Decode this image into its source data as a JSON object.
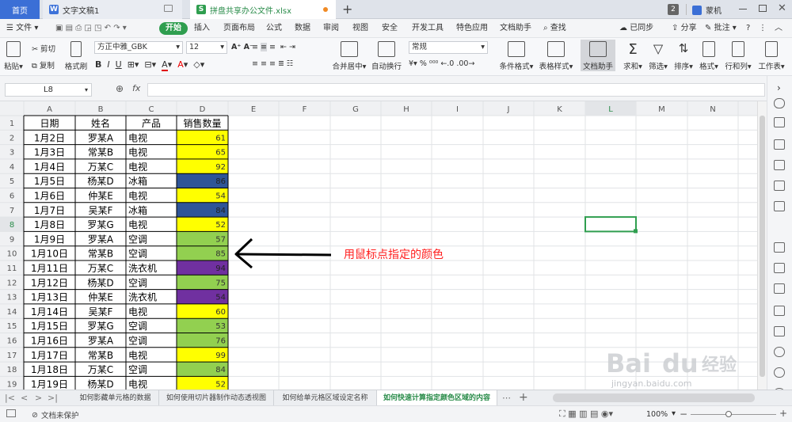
{
  "titlebar": {
    "home": "首页",
    "doc_tab": "文字文稿1",
    "active_tab": "拼盘共享办公文件.xlsx",
    "plus": "+",
    "badge": "2",
    "user": "蒙机"
  },
  "menubar": {
    "file": "文件",
    "items": [
      "开始",
      "插入",
      "页面布局",
      "公式",
      "数据",
      "审阅",
      "视图",
      "安全",
      "开发工具",
      "特色应用",
      "文档助手"
    ],
    "search": "查找",
    "sync": "已同步",
    "share": "分享",
    "comment": "批注"
  },
  "ribbon": {
    "paste": "粘贴",
    "cut": "剪切",
    "copy": "复制",
    "format_painter": "格式刷",
    "font_name": "方正中雅_GBK",
    "font_size": "12",
    "merge": "合并居中",
    "wrap": "自动换行",
    "number_format": "常规",
    "cond_format": "条件格式",
    "table_style": "表格样式",
    "doc_assist": "文档助手",
    "sum": "求和",
    "filter": "筛选",
    "sort": "排序",
    "format": "格式",
    "rowcol": "行和列",
    "sheet": "工作表"
  },
  "formula": {
    "name_box": "L8",
    "fx": "fx",
    "value": ""
  },
  "columns": [
    "A",
    "B",
    "C",
    "D",
    "E",
    "F",
    "G",
    "H",
    "I",
    "J",
    "K",
    "L",
    "M",
    "N"
  ],
  "headers": [
    "日期",
    "姓名",
    "产品",
    "销售数量"
  ],
  "rows": [
    {
      "n": "2",
      "date": "1月2日",
      "name": "罗某A",
      "product": "电视",
      "qty": "61",
      "color": "#ffff00",
      "dark": false
    },
    {
      "n": "3",
      "date": "1月3日",
      "name": "常某B",
      "product": "电视",
      "qty": "65",
      "color": "#ffff00",
      "dark": false
    },
    {
      "n": "4",
      "date": "1月4日",
      "name": "万某C",
      "product": "电视",
      "qty": "92",
      "color": "#ffff00",
      "dark": false
    },
    {
      "n": "5",
      "date": "1月5日",
      "name": "杨某D",
      "product": "冰箱",
      "qty": "86",
      "color": "#2f5597",
      "dark": true
    },
    {
      "n": "6",
      "date": "1月6日",
      "name": "仲某E",
      "product": "电视",
      "qty": "54",
      "color": "#ffff00",
      "dark": false
    },
    {
      "n": "7",
      "date": "1月7日",
      "name": "吴某F",
      "product": "冰箱",
      "qty": "84",
      "color": "#2f5597",
      "dark": true
    },
    {
      "n": "8",
      "date": "1月8日",
      "name": "罗某G",
      "product": "电视",
      "qty": "52",
      "color": "#ffff00",
      "dark": false
    },
    {
      "n": "9",
      "date": "1月9日",
      "name": "罗某A",
      "product": "空调",
      "qty": "57",
      "color": "#92d050",
      "dark": false
    },
    {
      "n": "10",
      "date": "1月10日",
      "name": "常某B",
      "product": "空调",
      "qty": "85",
      "color": "#92d050",
      "dark": false
    },
    {
      "n": "11",
      "date": "1月11日",
      "name": "万某C",
      "product": "洗衣机",
      "qty": "94",
      "color": "#7030a0",
      "dark": true
    },
    {
      "n": "12",
      "date": "1月12日",
      "name": "杨某D",
      "product": "空调",
      "qty": "75",
      "color": "#92d050",
      "dark": false
    },
    {
      "n": "13",
      "date": "1月13日",
      "name": "仲某E",
      "product": "洗衣机",
      "qty": "54",
      "color": "#7030a0",
      "dark": true
    },
    {
      "n": "14",
      "date": "1月14日",
      "name": "吴某F",
      "product": "电视",
      "qty": "60",
      "color": "#ffff00",
      "dark": false
    },
    {
      "n": "15",
      "date": "1月15日",
      "name": "罗某G",
      "product": "空调",
      "qty": "53",
      "color": "#92d050",
      "dark": false
    },
    {
      "n": "16",
      "date": "1月16日",
      "name": "罗某A",
      "product": "空调",
      "qty": "76",
      "color": "#92d050",
      "dark": false
    },
    {
      "n": "17",
      "date": "1月17日",
      "name": "常某B",
      "product": "电视",
      "qty": "99",
      "color": "#ffff00",
      "dark": false
    },
    {
      "n": "18",
      "date": "1月18日",
      "name": "万某C",
      "product": "空调",
      "qty": "84",
      "color": "#92d050",
      "dark": false
    },
    {
      "n": "19",
      "date": "1月19日",
      "name": "杨某D",
      "product": "电视",
      "qty": "52",
      "color": "#ffff00",
      "dark": false
    }
  ],
  "annotation": "用鼠标点指定的颜色",
  "sheets": [
    "如何影藏单元格的数据",
    "如何使用切片器制作动态透视图",
    "如何给单元格区域设定名称",
    "如何快速计算指定颜色区域的内容"
  ],
  "status": {
    "protect": "文档未保护",
    "zoom": "100%"
  },
  "watermark": {
    "brand": "Bai",
    "brand2": "du",
    "label": "经验",
    "url": "jingyan.baidu.com"
  }
}
